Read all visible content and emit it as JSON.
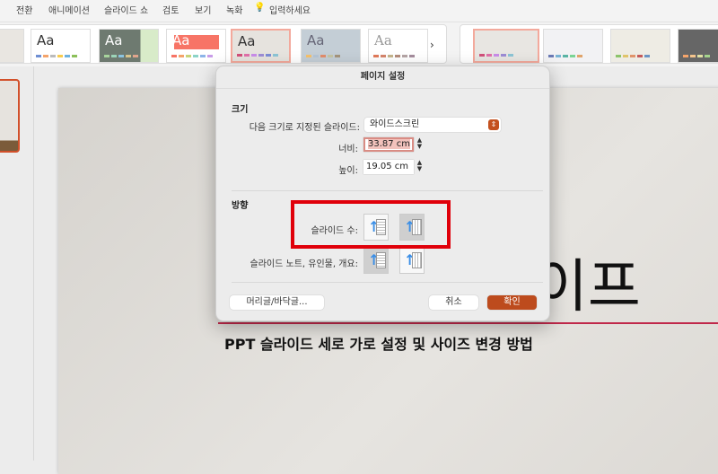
{
  "menu": {
    "tabs": [
      "전환",
      "애니메이션",
      "슬라이드 쇼",
      "검토",
      "보기",
      "녹화"
    ],
    "tell_me": "입력하세요"
  },
  "ribbon": {
    "themes_count_visible": 7,
    "variants_count_visible": 4,
    "more_icon": "chevron-right-icon"
  },
  "slide": {
    "title_partial": "이프",
    "subtitle": "PPT 슬라이드 세로 가로 설정 및 사이즈 변경 방법",
    "accent": "#c0284a"
  },
  "dialog": {
    "title": "페이지 설정",
    "size_section": "크기",
    "slide_size_label": "다음 크기로 지정된 슬라이드:",
    "slide_size_value": "와이드스크린",
    "width_label": "너비:",
    "width_value": "33.87 cm",
    "height_label": "높이:",
    "height_value": "19.05 cm",
    "orientation_section": "방향",
    "slides_label": "슬라이드 수:",
    "notes_label": "슬라이드 노트, 유인물, 개요:",
    "slides_orientation": "landscape",
    "notes_orientation": "portrait",
    "header_footer_button": "머리글/바닥글...",
    "cancel_button": "취소",
    "ok_button": "확인",
    "accent": "#bd4b1d",
    "highlight": "#e0000a"
  }
}
